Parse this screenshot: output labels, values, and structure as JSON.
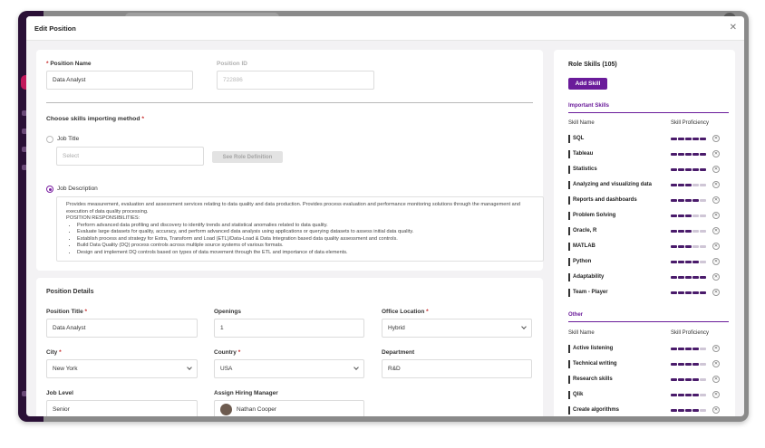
{
  "modal": {
    "title": "Edit Position",
    "close_icon": "close-icon"
  },
  "position": {
    "name_label": "Position Name",
    "name_value": "Data Analyst",
    "id_label": "Position ID",
    "id_value": "722886"
  },
  "import": {
    "title": "Choose skills importing method",
    "job_title_label": "Job Title",
    "job_title_placeholder": "Select",
    "see_role_button": "See Role Definition",
    "job_description_label": "Job Description",
    "description_intro": "Provides measurement, evaluation and assessment services relating to data quality and data production. Provides process evaluation and performance monitoring solutions through the management and execution of data quality processing.",
    "responsibilities_heading": "POSITION RESPONSIBILITIES:",
    "responsibilities": [
      "Perform advanced data profiling and discovery to identify trends and statistical anomalies related to data quality.",
      "Evaluate large datasets for quality, accuracy, and perform advanced data analysis using applications or querying datasets to assess initial data quality.",
      "Establish process and strategy for Extra, Transform and Load (ETL)/Data-Load & Data Integration based data quality assessment and controls.",
      "Build Data Quality (DQ) process controls across multiple source systems of various formats.",
      "Design and implement DQ controls based on types of data movement through the ETL and importance of data elements."
    ]
  },
  "details": {
    "title": "Position Details",
    "position_title_label": "Position Title",
    "position_title_value": "Data Analyst",
    "openings_label": "Openings",
    "openings_value": "1",
    "office_label": "Office Location",
    "office_value": "Hybrid",
    "city_label": "City",
    "city_value": "New York",
    "country_label": "Country",
    "country_value": "USA",
    "department_label": "Department",
    "department_value": "R&D",
    "job_level_label": "Job Level",
    "job_level_value": "Senior",
    "manager_label": "Assign Hiring Manager",
    "manager_value": "Nathan Cooper"
  },
  "skills": {
    "title": "Role Skills (105)",
    "add_button": "Add Skill",
    "col_name": "Skill Name",
    "col_prof": "Skill Proficiency",
    "important_title": "Important Skills",
    "important": [
      {
        "name": "SQL",
        "level": 5
      },
      {
        "name": "Tableau",
        "level": 5
      },
      {
        "name": "Statistics",
        "level": 5
      },
      {
        "name": "Analyzing and visualizing data",
        "level": 3
      },
      {
        "name": "Reports and dashboards",
        "level": 4
      },
      {
        "name": "Problem Solving",
        "level": 3
      },
      {
        "name": "Oracle, R",
        "level": 3
      },
      {
        "name": "MATLAB",
        "level": 3
      },
      {
        "name": "Python",
        "level": 4
      },
      {
        "name": "Adaptability",
        "level": 5
      },
      {
        "name": "Team - Player",
        "level": 5
      }
    ],
    "other_title": "Other",
    "other": [
      {
        "name": "Active listening",
        "level": 4
      },
      {
        "name": "Technical writing",
        "level": 4
      },
      {
        "name": "Research skills",
        "level": 4
      },
      {
        "name": "Qlik",
        "level": 4
      },
      {
        "name": "Create algorithms",
        "level": 4
      }
    ],
    "colors": {
      "accent": "#6a1b9a",
      "bar_on": "#4a1b6b",
      "bar_off": "#cfc6d6"
    }
  }
}
